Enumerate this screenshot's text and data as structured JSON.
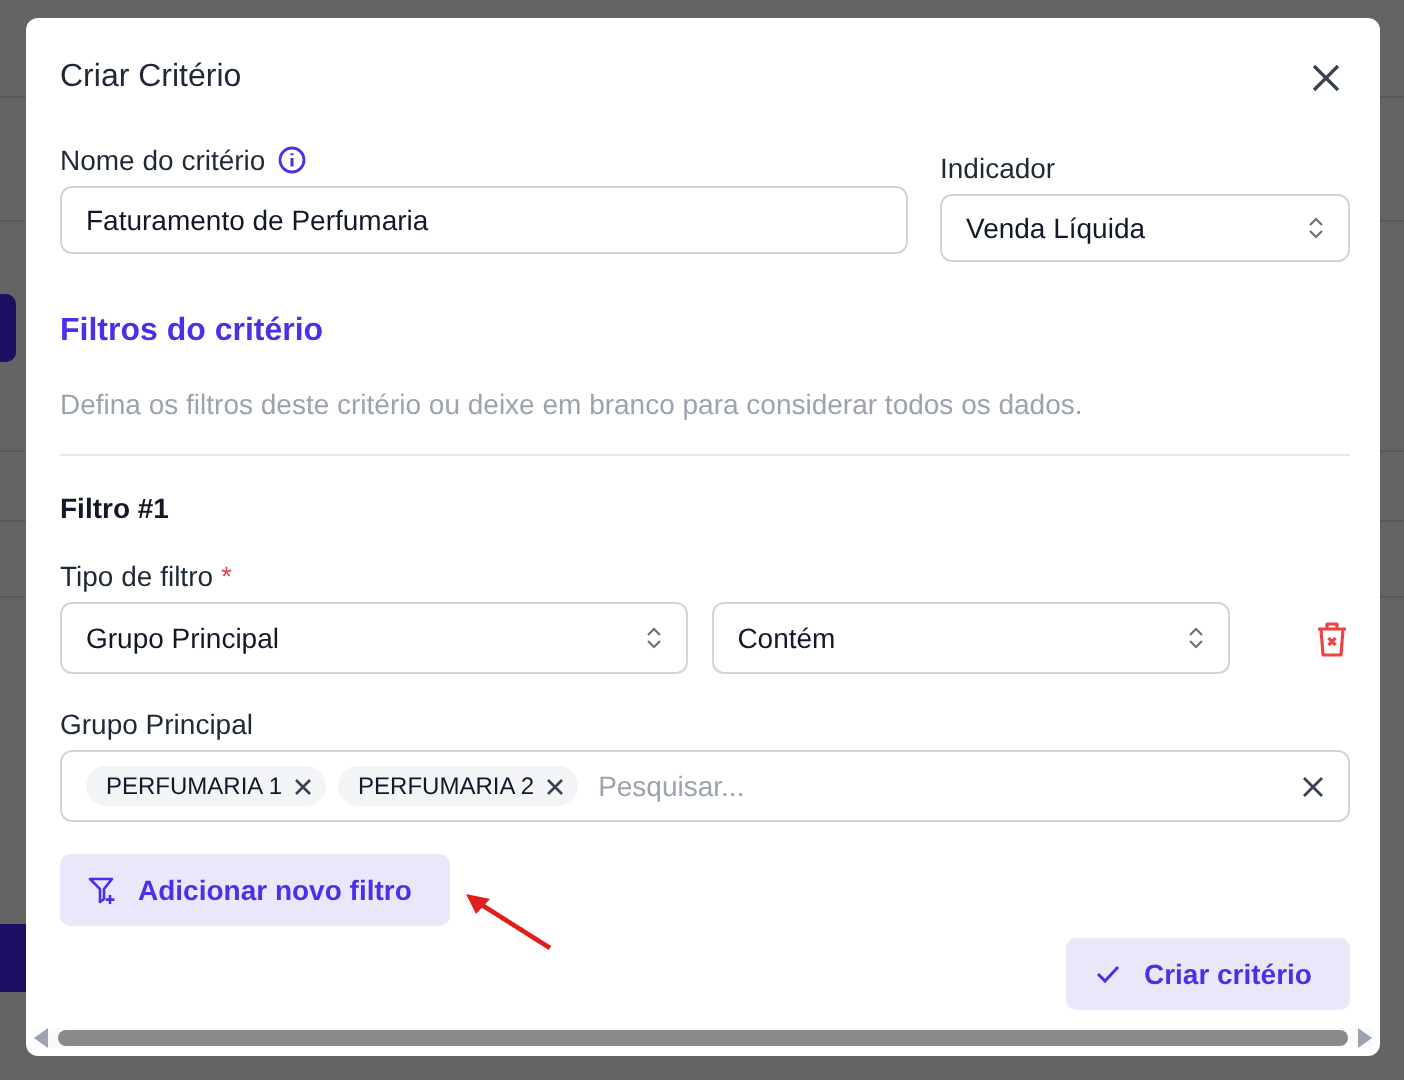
{
  "dialog": {
    "title": "Criar Critério"
  },
  "name_field": {
    "label": "Nome do critério",
    "value": "Faturamento de Perfumaria"
  },
  "indicator_field": {
    "label": "Indicador",
    "value": "Venda Líquida"
  },
  "filters_section": {
    "title": "Filtros do critério",
    "description": "Defina os filtros deste critério ou deixe em branco para considerar todos os dados."
  },
  "filters": [
    {
      "title": "Filtro #1",
      "type_label": "Tipo de filtro",
      "required_mark": "*",
      "type_value": "Grupo Principal",
      "operator_value": "Contém",
      "values_label": "Grupo Principal",
      "tags": [
        "PERFUMARIA 1",
        "PERFUMARIA 2"
      ],
      "search_placeholder": "Pesquisar..."
    }
  ],
  "add_filter_button": "Adicionar novo filtro",
  "submit_button": "Criar critério"
}
